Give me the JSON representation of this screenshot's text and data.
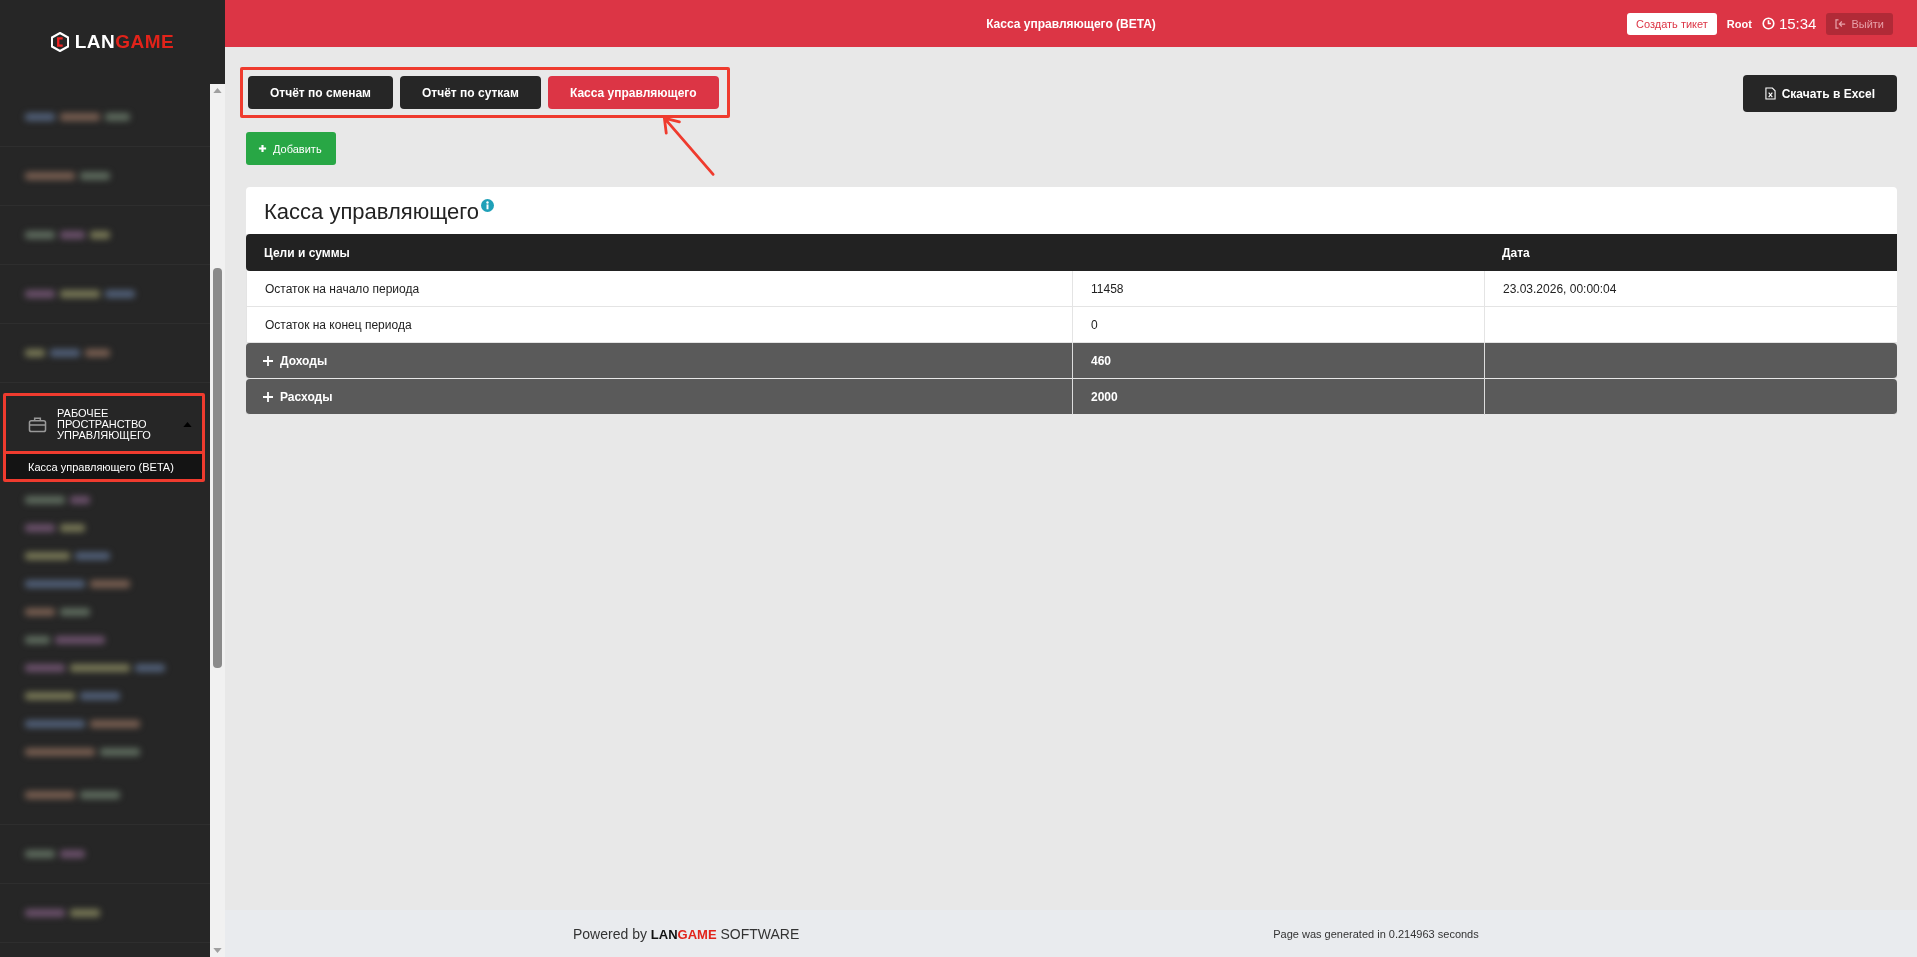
{
  "logo": {
    "text_1": "LAN",
    "text_2": "GAME"
  },
  "sidebar": {
    "group": {
      "label": "РАБОЧЕЕ ПРОСТРАНСТВО УПРАВЛЯЮЩЕГО",
      "expanded": true,
      "children": [
        {
          "label": "Касса управляющего (BETA)",
          "selected": true
        }
      ]
    }
  },
  "header": {
    "title": "Касса управляющего (BETA)",
    "ticket_button": "Создать тикет",
    "user": "Root",
    "time": "15:34",
    "logout_button": "Выйти"
  },
  "tabs": [
    {
      "label": "Отчёт по сменам",
      "selected": false
    },
    {
      "label": "Отчёт по суткам",
      "selected": false
    },
    {
      "label": "Касса управляющего",
      "selected": true
    }
  ],
  "excel_button": "Скачать в Excel",
  "add_button": "Добавить",
  "card": {
    "title": "Касса управляющего",
    "columns": [
      {
        "label": "Цели и суммы"
      },
      {
        "label": "Дата"
      }
    ],
    "rows": [
      {
        "kind": "plain",
        "label": "Остаток на начало периода",
        "value": "11458",
        "date": "23.03.2026, 00:00:04"
      },
      {
        "kind": "plain",
        "label": "Остаток на конец периода",
        "value": "0"
      },
      {
        "kind": "group",
        "label": "Доходы",
        "value": "460",
        "expanded": false
      },
      {
        "kind": "group",
        "label": "Расходы",
        "value": "2000",
        "expanded": false
      }
    ]
  },
  "footer": {
    "prefix": "Powered by",
    "brand_1": "LAN",
    "brand_2": "GAME",
    "suffix": "SOFTWARE",
    "generated": "Page was generated in 0.214963 seconds"
  }
}
